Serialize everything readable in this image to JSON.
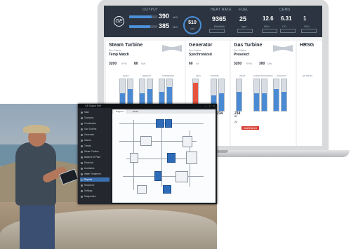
{
  "dashboard": {
    "brand": "GE",
    "header": {
      "output": {
        "label": "OUTPUT",
        "value1": "390",
        "unit1": "MW",
        "value2": "385",
        "unit2": "MW"
      },
      "dial": {
        "value": "510",
        "unit": "MW"
      },
      "heat_rate": {
        "label": "HEAT RATE",
        "value": "9365",
        "unit": "Btu/kWh"
      },
      "fuel": {
        "label": "FUEL",
        "value": "25",
        "unit": "kg/s"
      },
      "ems": {
        "label": "CEMS",
        "values": [
          "12.6",
          "6.31",
          "1"
        ],
        "units": [
          "NOx",
          "CO",
          "SOx"
        ]
      }
    },
    "sections": [
      {
        "title": "Steam Turbine",
        "status_label": "Run Status",
        "status": "Temp Match",
        "speed": "3200",
        "speed_unit": "RPM",
        "output": "80",
        "output_unit": "MW"
      },
      {
        "title": "Generator",
        "status_label": "Run Status",
        "status": "Synchronized",
        "freq": "60",
        "freq_unit": "Hz"
      },
      {
        "title": "Gas Turbine",
        "status_label": "Run Status",
        "status": "Preselect",
        "speed": "3200",
        "speed_unit": "RPM",
        "output": "300",
        "output_unit": "MW"
      },
      {
        "title": "HRSG",
        "status_label": "",
        "status": ""
      }
    ],
    "gauge_groups": [
      "INLET",
      "REHEAT",
      "CONDENSE",
      "GEN",
      "STATOR",
      "INLET",
      "COMP DISCHARGE",
      "EXHAUST",
      "HP DRUM"
    ],
    "gauge_values": [
      "234",
      "234",
      "234",
      "234",
      "234",
      "234",
      "234",
      "234",
      "234",
      "234"
    ],
    "gauge_fill": [
      0.55,
      0.7,
      0.55,
      0.7,
      0.6,
      0.75,
      0.9,
      0.5,
      0.55,
      0.6,
      0.55,
      0.55,
      0.7,
      0.6
    ],
    "gauge_red": [
      false,
      false,
      false,
      false,
      false,
      false,
      true,
      false,
      false,
      false,
      false,
      false,
      false,
      false
    ],
    "status_values": {
      "val_a": "82",
      "val_b": "23"
    },
    "warning": "WARNING"
  },
  "software": {
    "window_title": "GE Digital HMI",
    "sidebar_items": [
      "Main",
      "Overview",
      "Combustion",
      "Gas Turbine",
      "Generator",
      "Alarms",
      "Trends",
      "Steam Turbine",
      "Balance of Plant",
      "Electrical",
      "Auxiliaries",
      "Water Treatment",
      "Reports",
      "Sequence",
      "Settings",
      "Diagnostics"
    ],
    "selected_index": 12,
    "tabs": [
      "Diagram",
      "Detail"
    ]
  }
}
